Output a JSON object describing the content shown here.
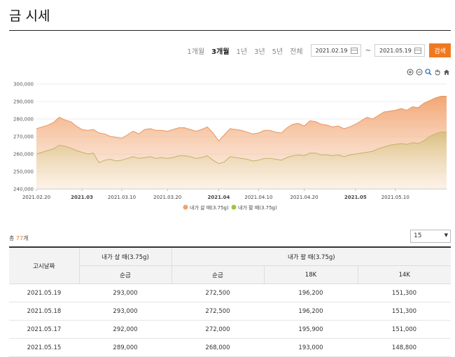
{
  "page": {
    "title": "금 시세"
  },
  "filters": {
    "periods": [
      {
        "label": "1개월",
        "active": false
      },
      {
        "label": "3개월",
        "active": true
      },
      {
        "label": "1년",
        "active": false
      },
      {
        "label": "3년",
        "active": false
      },
      {
        "label": "5년",
        "active": false
      },
      {
        "label": "전체",
        "active": false
      }
    ],
    "start_date": "2021.02.19",
    "separator": "~",
    "end_date": "2021.05.19",
    "search_label": "검색"
  },
  "toolbar_icons": [
    "zoom-in-icon",
    "zoom-out-icon",
    "magnify-icon",
    "pan-hand-icon",
    "home-icon"
  ],
  "chart_data": {
    "type": "area",
    "ylim": [
      240000,
      300000
    ],
    "yticks": [
      "300,000",
      "290,000",
      "280,000",
      "270,000",
      "260,000",
      "250,000",
      "240,000"
    ],
    "xticks": [
      {
        "label": "2021.02.20",
        "bold": false,
        "i": 0
      },
      {
        "label": "2021.03",
        "bold": true,
        "i": 8
      },
      {
        "label": "2021.03.10",
        "bold": false,
        "i": 15
      },
      {
        "label": "2021.03.20",
        "bold": false,
        "i": 23
      },
      {
        "label": "2021.04",
        "bold": true,
        "i": 32
      },
      {
        "label": "2021.04.10",
        "bold": false,
        "i": 39
      },
      {
        "label": "2021.04.20",
        "bold": false,
        "i": 47
      },
      {
        "label": "2021.05",
        "bold": true,
        "i": 56
      },
      {
        "label": "2021.05.10",
        "bold": false,
        "i": 63
      }
    ],
    "series": [
      {
        "name": "내가 살 때(3.75g)",
        "color": "#f0a26e",
        "values": [
          274500,
          275500,
          276500,
          278000,
          281000,
          279500,
          278500,
          276000,
          274000,
          273500,
          274000,
          272000,
          271500,
          270000,
          269500,
          269000,
          271000,
          273000,
          271500,
          274000,
          274500,
          273500,
          273500,
          273000,
          274000,
          275000,
          275000,
          274000,
          273000,
          274000,
          275500,
          272000,
          267500,
          271000,
          274500,
          274000,
          273500,
          272500,
          271500,
          272000,
          273500,
          273500,
          272500,
          272000,
          275000,
          277000,
          277500,
          276000,
          279000,
          278500,
          277000,
          276500,
          275500,
          276000,
          274500,
          275500,
          277000,
          279000,
          281000,
          280000,
          282000,
          284000,
          284500,
          285000,
          286000,
          285000,
          287000,
          286500,
          289000,
          290500,
          292000,
          293000,
          293000
        ]
      },
      {
        "name": "내가 팔 때(3.75g)",
        "color": "#9bc83c",
        "values": [
          260000,
          261000,
          262000,
          263000,
          265000,
          264500,
          263500,
          262000,
          261000,
          260000,
          260500,
          255000,
          256500,
          257000,
          256000,
          256500,
          257500,
          258500,
          257500,
          258000,
          258500,
          257500,
          258000,
          257500,
          258000,
          259000,
          259000,
          258500,
          257500,
          258000,
          259000,
          256500,
          254500,
          255500,
          258500,
          258000,
          257500,
          257000,
          256000,
          256500,
          257500,
          257500,
          257000,
          256500,
          258000,
          259000,
          259500,
          259000,
          260500,
          260500,
          259500,
          259500,
          259000,
          259500,
          258500,
          259500,
          260000,
          260500,
          261000,
          261500,
          263000,
          264000,
          265000,
          265500,
          266000,
          265500,
          266500,
          266000,
          267500,
          270000,
          271500,
          272500,
          272500
        ]
      }
    ]
  },
  "summary": {
    "prefix": "총 ",
    "count": "77",
    "suffix": "개"
  },
  "page_size": {
    "value": "15"
  },
  "table": {
    "date_header": "고시날짜",
    "buy_group": "내가 살 때(3.75g)",
    "sell_group": "내가 팔 때(3.75g)",
    "sub_headers": [
      "순금",
      "순금",
      "18K",
      "14K"
    ],
    "rows": [
      [
        "2021.05.19",
        "293,000",
        "272,500",
        "196,200",
        "151,300"
      ],
      [
        "2021.05.18",
        "293,000",
        "272,500",
        "196,200",
        "151,300"
      ],
      [
        "2021.05.17",
        "292,000",
        "272,000",
        "195,900",
        "151,000"
      ],
      [
        "2021.05.15",
        "289,000",
        "268,000",
        "193,000",
        "148,800"
      ]
    ]
  }
}
